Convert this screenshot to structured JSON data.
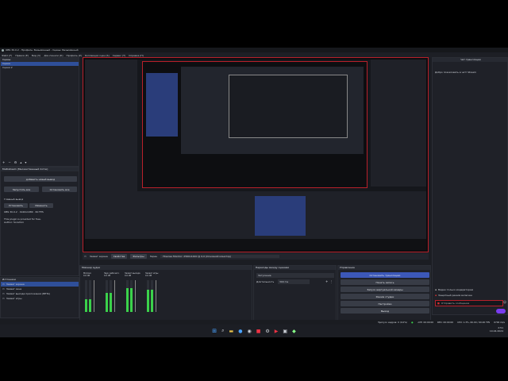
{
  "window": {
    "title": "OBS 30.0.2 - Профиль: Безымянный - Сцены: Безымянный"
  },
  "menu": [
    "Файл (F)",
    "Правка (E)",
    "Вид (V)",
    "Док-панели (D)",
    "Профиль (P)",
    "Коллекция сцен (S)",
    "Сервис (T)",
    "Справка (H)"
  ],
  "scenes": {
    "title": "Сцены",
    "items": [
      "Сцена",
      "Сцена 2"
    ]
  },
  "plugin": {
    "title": "Multistream (Множественный поток)",
    "add_label": "добавить новый вывод",
    "start_all": "Запустить все",
    "stop_all": "Остановить все",
    "main_label": "Главный вывод",
    "config_btn": "Установить",
    "edit_btn": "Изменить",
    "info": "OBS 30.0.2 · 1920x1080 · 60 FPS",
    "note": "This plugin is provided for free.",
    "author": "Author: SoraYuki"
  },
  "sources": {
    "title": "Источники",
    "items": [
      "Захват экрана",
      "Захват окна",
      "Захват выхода приложения (BETA)",
      "Захват игры"
    ]
  },
  "filter_bar": {
    "source": "Захват экрана",
    "properties": "Свойства",
    "filters": "Фильтры",
    "display_label": "Экран",
    "display_value": "Hisense Monitor: 2560x1440 @ 0,0 (Основной монитор)"
  },
  "mixer": {
    "title": "Микшер аудио",
    "channels": [
      {
        "name": "Mic/Aux",
        "db": "0.0 dB"
      },
      {
        "name": "Звук рабочего стола",
        "db": "0.0 dB"
      },
      {
        "name": "Захват выхода",
        "db": "0.0 dB"
      },
      {
        "name": "Захват игры",
        "db": "0.0 dB"
      }
    ],
    "level_range": "0 dB"
  },
  "transitions": {
    "title": "Переходы между сценами",
    "type": "Затухание",
    "duration_label": "Длительность",
    "duration": "300 ms"
  },
  "controls": {
    "title": "Управление",
    "buttons": [
      "Остановить трансляцию",
      "Начать запись",
      "Запуск виртуальной камеры",
      "Режим студии",
      "Настройки",
      "Выход"
    ]
  },
  "chat": {
    "title": "Чат трансляции",
    "message": "Добро пожаловать в чат! Stream",
    "option1": "Видео только модераторам",
    "option2": "Защитный режим включен",
    "input_placeholder": "Отправить сообщение"
  },
  "statusbar": {
    "dropped": "Пропуск кадров: 0 (0.0%)",
    "live": "LIVE: 00:00:00",
    "rec": "REC: 00:00:00",
    "cpu": "CPU: 1.3%, 60.00 / 60.00 FPS",
    "kbps": "6700 kb/s"
  },
  "taskbar": {
    "time": "2:51",
    "date": "10.04.2024"
  },
  "colors": {
    "accent": "#3c58b8",
    "live": "#b8202a",
    "meter_green": "#3bd24b"
  }
}
